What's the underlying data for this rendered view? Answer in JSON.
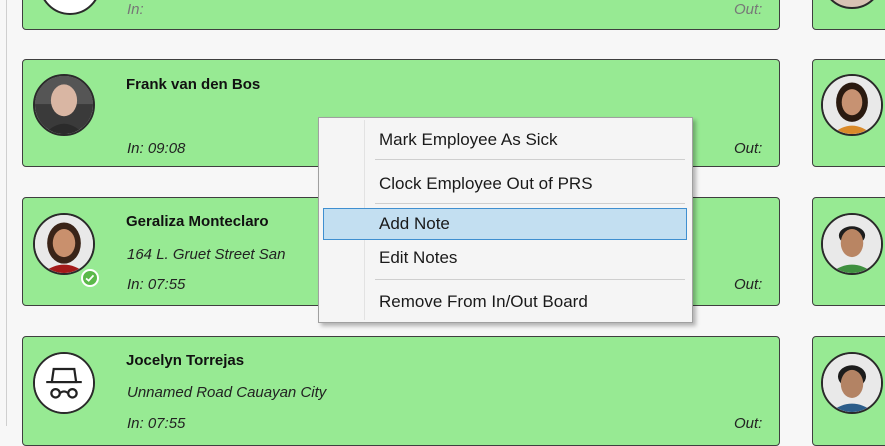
{
  "cards": [
    {
      "name": "",
      "address": "",
      "in_label": "In:",
      "out_label": "Out:"
    },
    {
      "name": "Frank van den Bos",
      "address": "",
      "in_label": "In: 09:08",
      "out_label": "Out:"
    },
    {
      "name": "Geraliza Monteclaro",
      "address": "164 L. Gruet Street San",
      "in_label": "In: 07:55",
      "out_label": "Out:"
    },
    {
      "name": "Jocelyn Torrejas",
      "address": "Unnamed Road Cauayan City",
      "in_label": "In: 07:55",
      "out_label": "Out:"
    }
  ],
  "context_menu": {
    "items": [
      {
        "label": "Mark Employee As Sick"
      },
      {
        "label": "Clock Employee Out of PRS"
      },
      {
        "label": "Add Note",
        "highlighted": true
      },
      {
        "label": "Edit Notes"
      },
      {
        "label": "Remove From In/Out Board"
      }
    ]
  },
  "colors": {
    "card_bg": "#97ea93",
    "highlight": "#c3dff1",
    "highlight_border": "#3f8fd0",
    "check": "#5bb94a"
  },
  "icons": {
    "anonymous_avatar": "incognito-icon",
    "status": "check-icon"
  }
}
